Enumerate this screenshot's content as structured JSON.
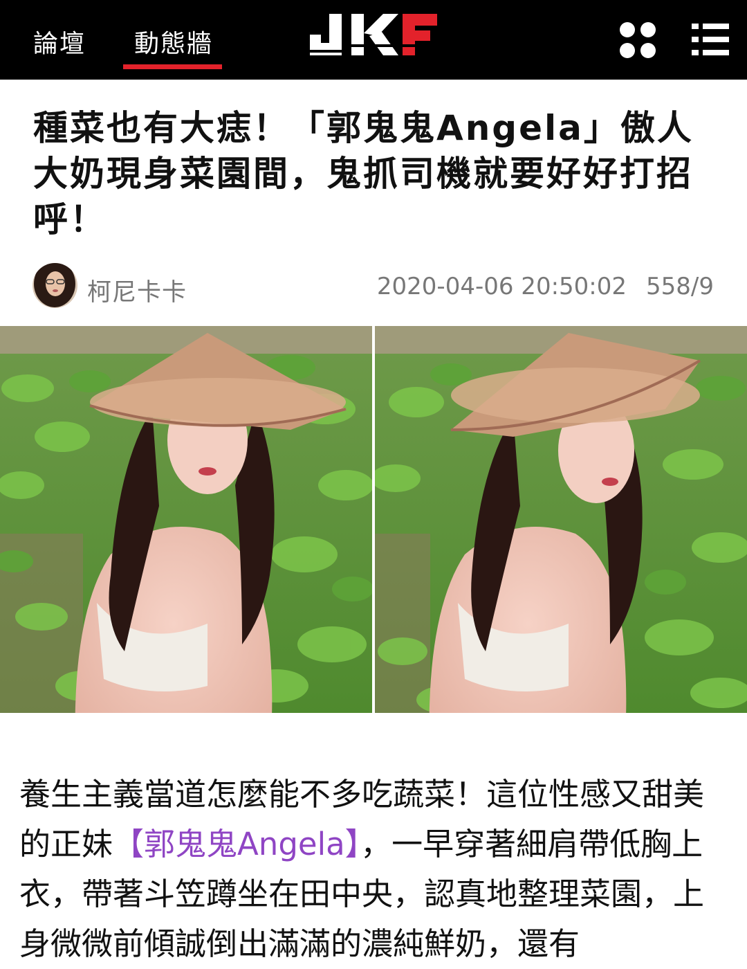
{
  "header": {
    "tabs": [
      {
        "label": "論壇"
      },
      {
        "label": "動態牆"
      }
    ],
    "logo_text": "JKF",
    "accent_color": "#e3222b",
    "icons": [
      "grid-icon",
      "menu-icon"
    ]
  },
  "article": {
    "title": "種菜也有大痣！「郭鬼鬼Angela」傲人大奶現身菜園間，鬼抓司機就要好好打招呼！",
    "author": "柯尼卡卡",
    "datetime": "2020-04-06 20:50:02",
    "views": "558/9",
    "body": {
      "part1": "養生主義當道怎麼能不多吃蔬菜！這位性感又甜美的正妹",
      "link": "【郭鬼鬼Angela】",
      "part2": "，一早穿著細肩帶低胸上衣，帶著斗笠蹲坐在田中央，認真地整理菜園，上身微微前傾誠倒出滿滿的濃純鮮奶，還有"
    },
    "link_color": "#8f45c4"
  }
}
